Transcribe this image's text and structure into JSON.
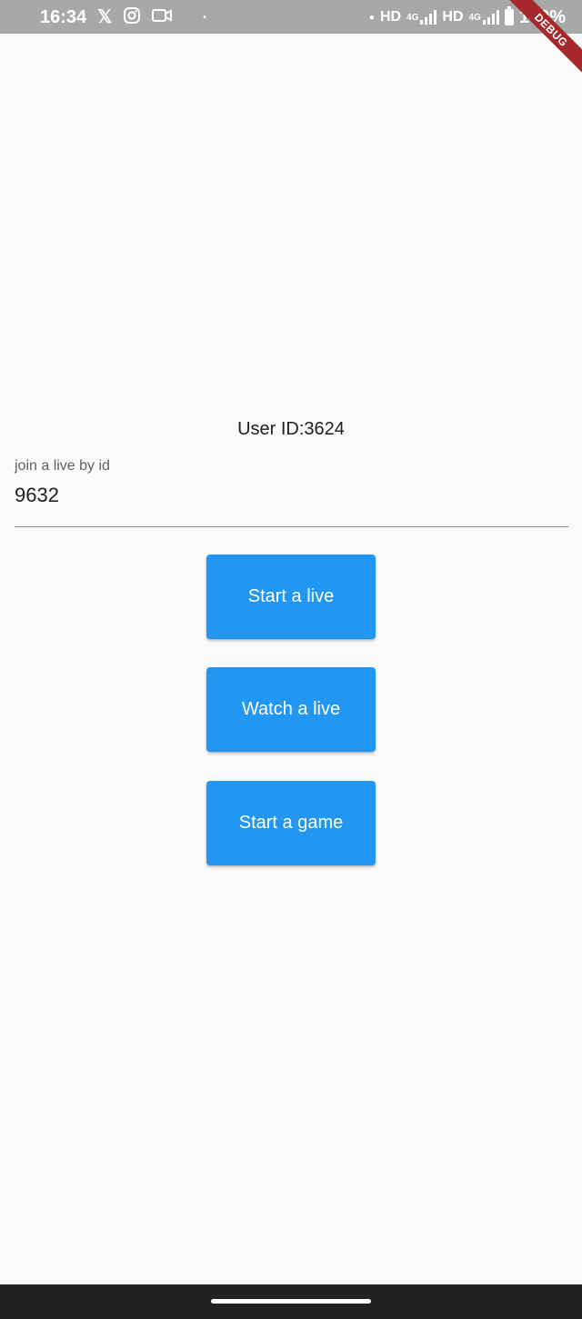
{
  "status_bar": {
    "time": "16:34",
    "icons_left": [
      "x-icon",
      "instagram-icon",
      "video-icon"
    ],
    "dot": "•",
    "network_1": "HD",
    "network_1_type": "4G",
    "network_2": "HD",
    "network_2_type": "4G",
    "battery": "100%",
    "background": "#a8a8a8"
  },
  "debug_banner": {
    "label": "DEBUG",
    "color": "#a6292d"
  },
  "main": {
    "user_id": "User ID:3624",
    "join_field": {
      "label": "join a live by id",
      "value": "9632"
    },
    "buttons": {
      "start_live": "Start a live",
      "watch_live": "Watch a live",
      "start_game": "Start a game"
    },
    "accent_color": "#2196f3"
  }
}
